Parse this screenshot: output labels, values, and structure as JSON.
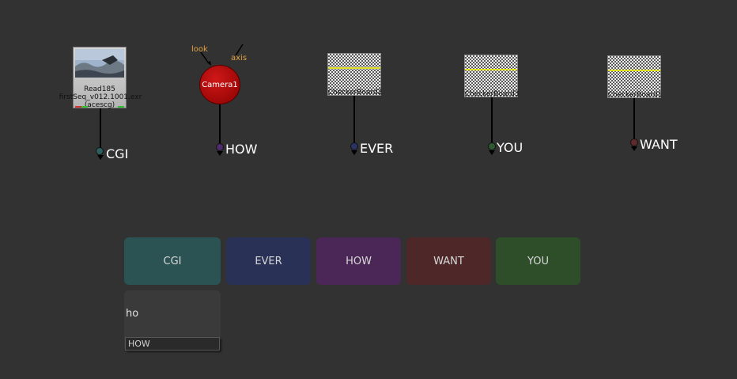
{
  "nodes": {
    "read": {
      "name": "Read185",
      "file": "firstSeq_v012.1001.exr",
      "colorspace": "(acescg)"
    },
    "camera": {
      "name": "Camera1",
      "inputs": [
        "look",
        "axis"
      ]
    },
    "checkers": [
      {
        "name": "CheckerBoard2"
      },
      {
        "name": "CheckerBoard3"
      },
      {
        "name": "CheckerBoard1"
      }
    ]
  },
  "dots": [
    {
      "label": "CGI",
      "color": "#2e5f5f"
    },
    {
      "label": "HOW",
      "color": "#4f2b6a"
    },
    {
      "label": "EVER",
      "color": "#2b3262"
    },
    {
      "label": "YOU",
      "color": "#2f5a2f"
    },
    {
      "label": "WANT",
      "color": "#5e2a2a"
    }
  ],
  "panel": {
    "buttons": [
      {
        "label": "CGI",
        "color": "#2c5353"
      },
      {
        "label": "EVER",
        "color": "#2a3156"
      },
      {
        "label": "HOW",
        "color": "#4a2756"
      },
      {
        "label": "WANT",
        "color": "#4e2828"
      },
      {
        "label": "YOU",
        "color": "#2e4e2a"
      }
    ],
    "search": {
      "value": "ho",
      "suggestion": "HOW"
    }
  }
}
